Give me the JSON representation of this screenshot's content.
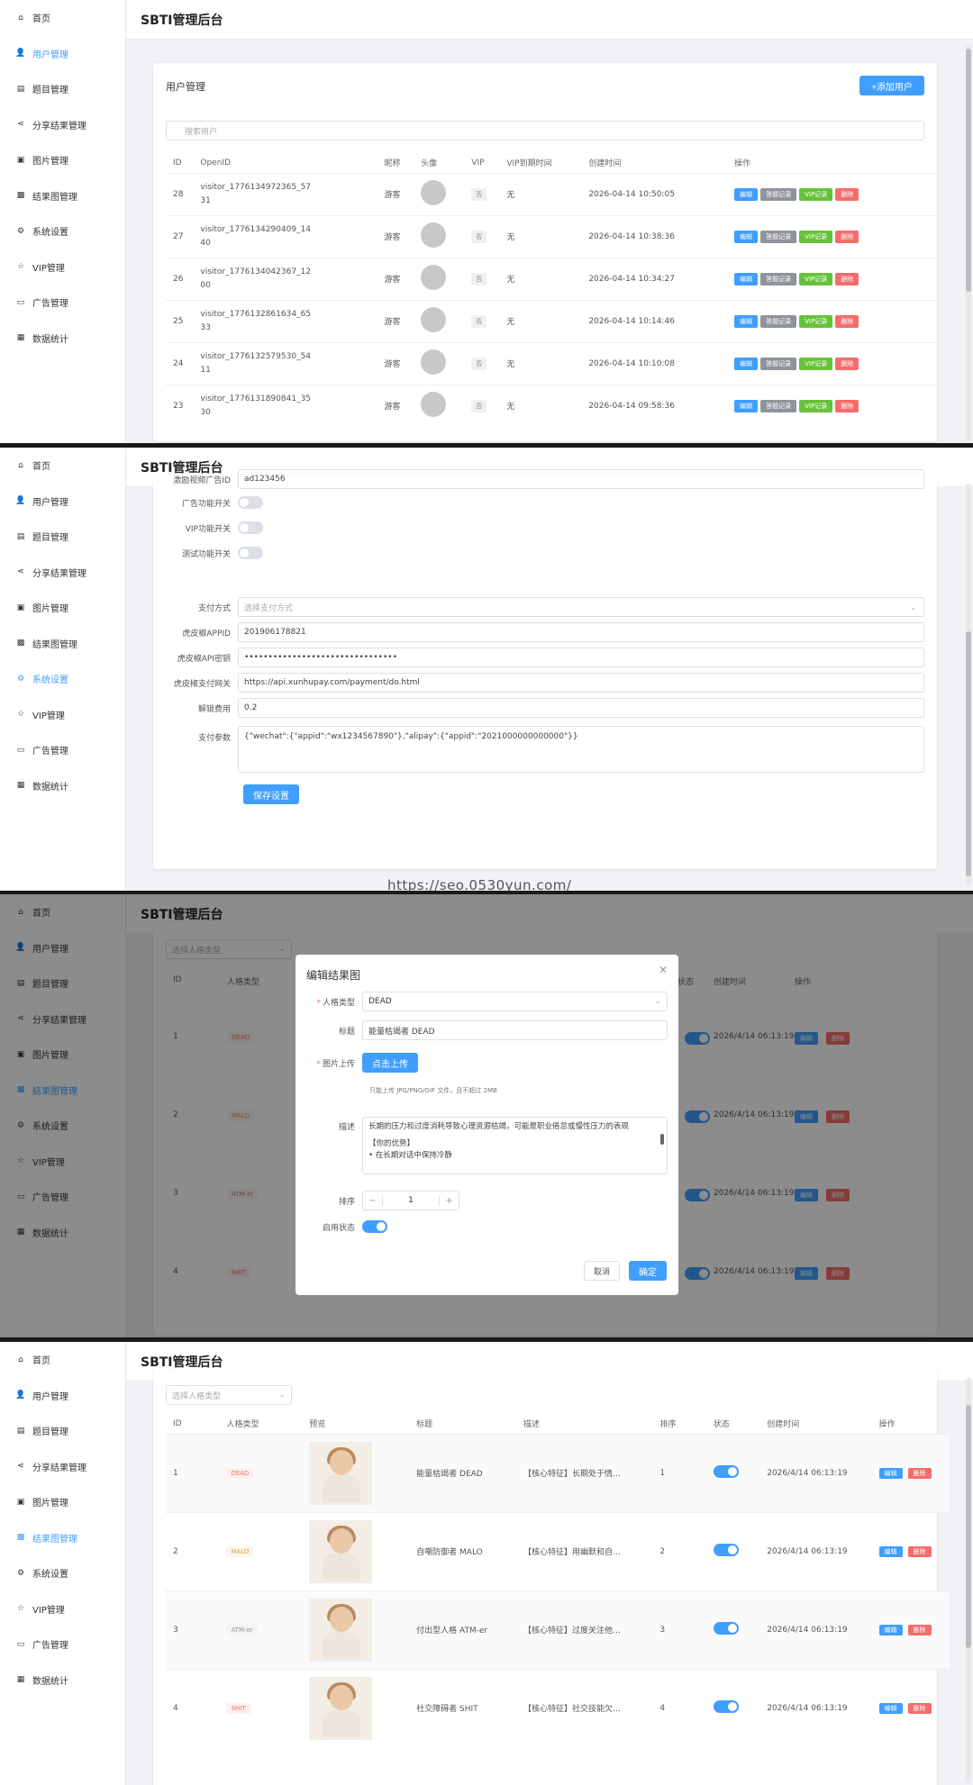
{
  "app_title": "SBTI管理后台",
  "sidebar": {
    "items": [
      {
        "label": "首页",
        "icon": "home-icon"
      },
      {
        "label": "用户管理",
        "icon": "user-icon"
      },
      {
        "label": "题目管理",
        "icon": "document-icon"
      },
      {
        "label": "分享结果管理",
        "icon": "share-icon"
      },
      {
        "label": "图片管理",
        "icon": "image-icon"
      },
      {
        "label": "结果图管理",
        "icon": "picture-icon"
      },
      {
        "label": "系统设置",
        "icon": "gear-icon"
      },
      {
        "label": "VIP管理",
        "icon": "star-icon"
      },
      {
        "label": "广告管理",
        "icon": "video-icon"
      },
      {
        "label": "数据统计",
        "icon": "chart-icon"
      }
    ]
  },
  "users": {
    "title": "用户管理",
    "add_button": "+添加用户",
    "search_placeholder": "搜索用户",
    "columns": [
      "ID",
      "OpenID",
      "昵称",
      "头像",
      "VIP",
      "VIP到期时间",
      "创建时间",
      "操作"
    ],
    "rows": [
      {
        "id": "28",
        "openid1": "visitor_1776134972365_57",
        "openid2": "31",
        "nick": "游客",
        "vip": "否",
        "expire": "无",
        "created": "2026-04-14 10:50:05"
      },
      {
        "id": "27",
        "openid1": "visitor_1776134290409_14",
        "openid2": "40",
        "nick": "游客",
        "vip": "否",
        "expire": "无",
        "created": "2026-04-14 10:38:36"
      },
      {
        "id": "26",
        "openid1": "visitor_1776134042367_12",
        "openid2": "00",
        "nick": "游客",
        "vip": "否",
        "expire": "无",
        "created": "2026-04-14 10:34:27"
      },
      {
        "id": "25",
        "openid1": "visitor_1776132861634_65",
        "openid2": "33",
        "nick": "游客",
        "vip": "否",
        "expire": "无",
        "created": "2026-04-14 10:14:46"
      },
      {
        "id": "24",
        "openid1": "visitor_1776132579530_54",
        "openid2": "11",
        "nick": "游客",
        "vip": "否",
        "expire": "无",
        "created": "2026-04-14 10:10:08"
      },
      {
        "id": "23",
        "openid1": "visitor_1776131890841_35",
        "openid2": "30",
        "nick": "游客",
        "vip": "否",
        "expire": "无",
        "created": "2026-04-14 09:58:36"
      }
    ],
    "ops": {
      "edit": "编辑",
      "records": "答题记录",
      "vip": "VIP记录",
      "delete": "删除"
    }
  },
  "settings": {
    "partial_top_label": "激励视频广告ID",
    "partial_top_value": "ad123456",
    "switches": [
      {
        "label": "广告功能开关",
        "on": false
      },
      {
        "label": "VIP功能开关",
        "on": false
      },
      {
        "label": "测试功能开关",
        "on": false
      }
    ],
    "pay_method_label": "支付方式",
    "pay_method_placeholder": "选择支付方式",
    "fields": [
      {
        "label": "虎皮椒APPID",
        "value": "201906178821"
      },
      {
        "label": "虎皮椒API密钥",
        "value": "••••••••••••••••••••••••••••••••"
      },
      {
        "label": "虎皮椒支付网关",
        "value": "https://api.xunhupay.com/payment/do.html"
      },
      {
        "label": "解锁费用",
        "value": "0.2"
      }
    ],
    "pay_params_label": "支付参数",
    "pay_params_value": "{\"wechat\":{\"appid\":\"wx1234567890\"},\"alipay\":{\"appid\":\"2021000000000000\"}}",
    "save_button": "保存设置",
    "watermark": "https://seo.0530yun.com/"
  },
  "dialog": {
    "title": "编辑结果图",
    "type_label": "人格类型",
    "type_value": "DEAD",
    "title_label": "标题",
    "title_value": "能量枯竭者 DEAD",
    "upload_label": "图片上传",
    "upload_button": "点击上传",
    "upload_hint": "只能上传 JPG/PNG/GIF 文件，且不超过 2MB",
    "desc_label": "描述",
    "desc_text": "长期的压力和过度消耗导致心理资源枯竭，可能是职业倦怠或慢性压力的表现",
    "desc_more1": "【你的优势】",
    "desc_more2": "• 在长期对话中保持冷静",
    "order_label": "排序",
    "order_value": "1",
    "status_label": "启用状态",
    "cancel": "取消",
    "confirm": "确定",
    "bg_filter": "选择人格类型",
    "bg_columns": [
      "ID",
      "人格类型",
      "状态",
      "创建时间",
      "操作"
    ],
    "bg_ids": [
      "1",
      "2",
      "3",
      "4"
    ],
    "bg_types": [
      "DEAD",
      "MALO",
      "ATM-er",
      "SHIT"
    ],
    "bg_time": "2026/4/14 06:13:19"
  },
  "results": {
    "filter_placeholder": "选择人格类型",
    "columns": [
      "ID",
      "人格类型",
      "预览",
      "标题",
      "描述",
      "排序",
      "状态",
      "创建时间",
      "操作"
    ],
    "rows": [
      {
        "id": "1",
        "type": "DEAD",
        "title": "能量枯竭者 DEAD",
        "desc": "【核心特征】长期处于情…",
        "order": "1",
        "time": "2026/4/14 06:13:19"
      },
      {
        "id": "2",
        "type": "MALO",
        "title": "自嘲防御者 MALO",
        "desc": "【核心特征】用幽默和自…",
        "order": "2",
        "time": "2026/4/14 06:13:19"
      },
      {
        "id": "3",
        "type": "ATM-er",
        "title": "付出型人格 ATM-er",
        "desc": "【核心特征】过度关注他…",
        "order": "3",
        "time": "2026/4/14 06:13:19"
      },
      {
        "id": "4",
        "type": "SHIT",
        "title": "社交障碍者 SHIT",
        "desc": "【核心特征】社交技能欠…",
        "order": "4",
        "time": "2026/4/14 06:13:19"
      }
    ],
    "edit": "编辑",
    "delete": "删除"
  }
}
